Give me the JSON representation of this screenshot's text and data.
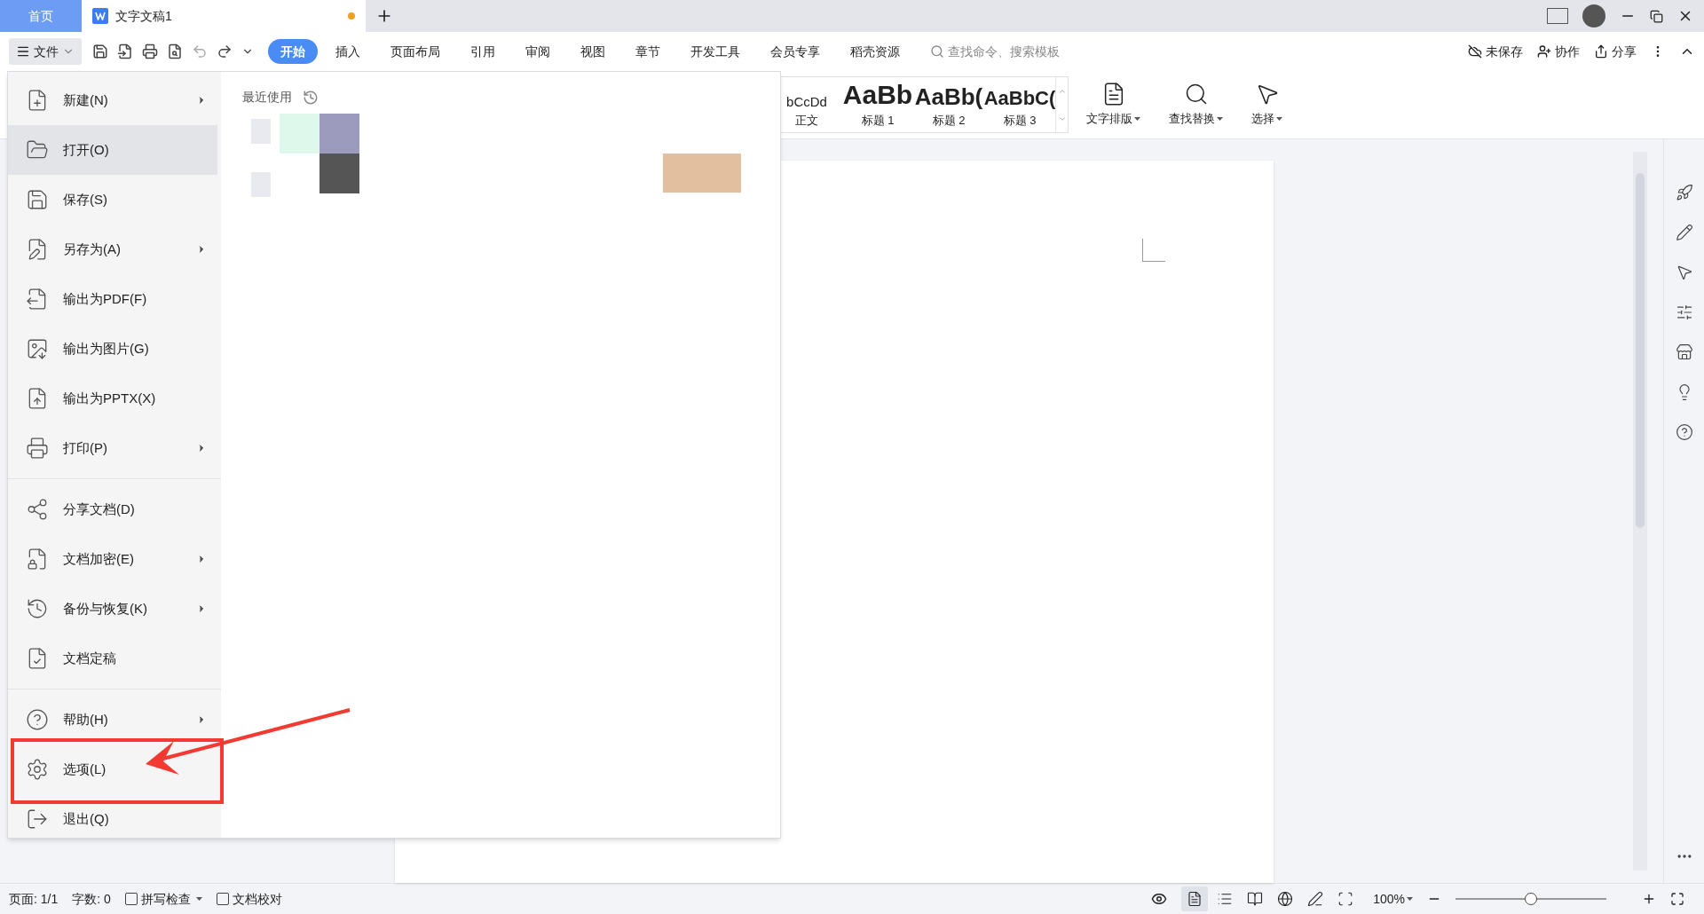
{
  "tabs": [
    {
      "label": "首页",
      "kind": "home",
      "selected": false
    },
    {
      "label": "文字文稿1",
      "kind": "doc",
      "selected": true,
      "modified": true
    }
  ],
  "toolbar": {
    "file_label": "文件",
    "ribbon_tabs": [
      {
        "label": "开始",
        "selected": true
      },
      {
        "label": "插入",
        "selected": false
      },
      {
        "label": "页面布局",
        "selected": false
      },
      {
        "label": "引用",
        "selected": false
      },
      {
        "label": "审阅",
        "selected": false
      },
      {
        "label": "视图",
        "selected": false
      },
      {
        "label": "章节",
        "selected": false
      },
      {
        "label": "开发工具",
        "selected": false
      },
      {
        "label": "会员专享",
        "selected": false
      },
      {
        "label": "稻壳资源",
        "selected": false
      }
    ],
    "search": {
      "placeholder": "查找命令、搜索模板"
    },
    "actions": [
      "未保存",
      "协作",
      "分享"
    ]
  },
  "ribbon": {
    "styles": [
      {
        "preview": "bCcDd",
        "label": "正文",
        "kind": "body"
      },
      {
        "preview": "AaBb",
        "label": "标题 1",
        "kind": "h1"
      },
      {
        "preview": "AaBb(",
        "label": "标题 2",
        "kind": "h2"
      },
      {
        "preview": "AaBbC(",
        "label": "标题 3",
        "kind": "h3"
      }
    ],
    "tools": [
      "文字排版",
      "查找替换",
      "选择"
    ]
  },
  "file_menu": {
    "groups": [
      {
        "items": [
          {
            "label": "新建(N)",
            "submenu": true,
            "selected": false,
            "annotated": false
          },
          {
            "label": "打开(O)",
            "submenu": false,
            "selected": true,
            "annotated": false
          },
          {
            "label": "保存(S)",
            "submenu": false,
            "selected": false,
            "annotated": false
          },
          {
            "label": "另存为(A)",
            "submenu": true,
            "selected": false,
            "annotated": false
          },
          {
            "label": "输出为PDF(F)",
            "submenu": false,
            "selected": false,
            "annotated": false
          },
          {
            "label": "输出为图片(G)",
            "submenu": false,
            "selected": false,
            "annotated": false
          },
          {
            "label": "输出为PPTX(X)",
            "submenu": false,
            "selected": false,
            "annotated": false
          },
          {
            "label": "打印(P)",
            "submenu": true,
            "selected": false,
            "annotated": false
          }
        ]
      },
      {
        "items": [
          {
            "label": "分享文档(D)",
            "submenu": false,
            "selected": false,
            "annotated": false
          },
          {
            "label": "文档加密(E)",
            "submenu": true,
            "selected": false,
            "annotated": false
          },
          {
            "label": "备份与恢复(K)",
            "submenu": true,
            "selected": false,
            "annotated": false
          },
          {
            "label": "文档定稿",
            "submenu": false,
            "selected": false,
            "annotated": false
          }
        ]
      },
      {
        "items": [
          {
            "label": "帮助(H)",
            "submenu": true,
            "selected": false,
            "annotated": false
          },
          {
            "label": "选项(L)",
            "submenu": false,
            "selected": false,
            "annotated": true
          },
          {
            "label": "退出(Q)",
            "submenu": false,
            "selected": false,
            "annotated": false
          }
        ]
      }
    ],
    "recent_title": "最近使用"
  },
  "status_bar": {
    "page": "页面: 1/1",
    "words": "字数: 0",
    "checks": [
      {
        "label": "拼写检查",
        "dropdown": true
      },
      {
        "label": "文档校对",
        "dropdown": false
      }
    ],
    "view_modes": [
      {
        "selected": true
      },
      {
        "selected": false
      },
      {
        "selected": false
      },
      {
        "selected": false
      },
      {
        "selected": false
      },
      {
        "selected": false
      }
    ],
    "zoom": "100%",
    "zoom_slider": {
      "level": 0.5
    }
  }
}
